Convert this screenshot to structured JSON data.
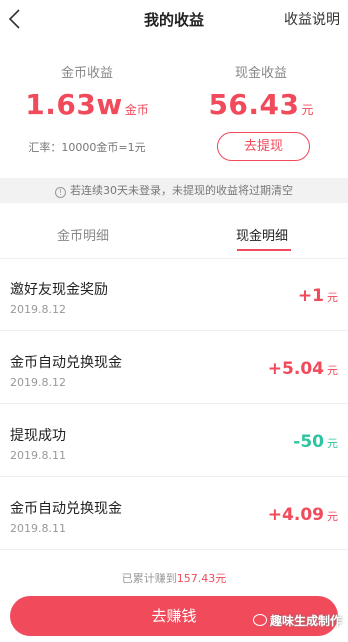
{
  "nav": {
    "title": "我的收益",
    "right_link": "收益说明",
    "back_icon": "chevron-left-icon"
  },
  "summary": {
    "coin": {
      "label": "金币收益",
      "value": "1.63w",
      "unit": "金币",
      "rate": "汇率：10000金币=1元"
    },
    "cash": {
      "label": "现金收益",
      "value": "56.43",
      "unit": "元",
      "withdraw_label": "去提现"
    }
  },
  "notice": {
    "icon": "info-icon",
    "text": "若连续30天未登录，未提现的收益将过期清空"
  },
  "tabs": [
    {
      "label": "金币明细",
      "active": false
    },
    {
      "label": "现金明细",
      "active": true
    }
  ],
  "records": [
    {
      "title": "邀好友现金奖励",
      "date": "2019.8.12",
      "amount": "+1",
      "unit": "元",
      "type": "income"
    },
    {
      "title": "金币自动兑换现金",
      "date": "2019.8.12",
      "amount": "+5.04",
      "unit": "元",
      "type": "income"
    },
    {
      "title": "提现成功",
      "date": "2019.8.11",
      "amount": "-50",
      "unit": "元",
      "type": "expense"
    },
    {
      "title": "金币自动兑换现金",
      "date": "2019.8.11",
      "amount": "+4.09",
      "unit": "元",
      "type": "income"
    }
  ],
  "footer": {
    "total_prefix": "已累计赚到",
    "total_value": "157.43元",
    "cta_label": "去赚钱",
    "watermark": "趣味生成制作"
  },
  "colors": {
    "accent": "#f04a5b",
    "expense": "#2ec4a0",
    "notice_bg": "#f2f2f2"
  }
}
